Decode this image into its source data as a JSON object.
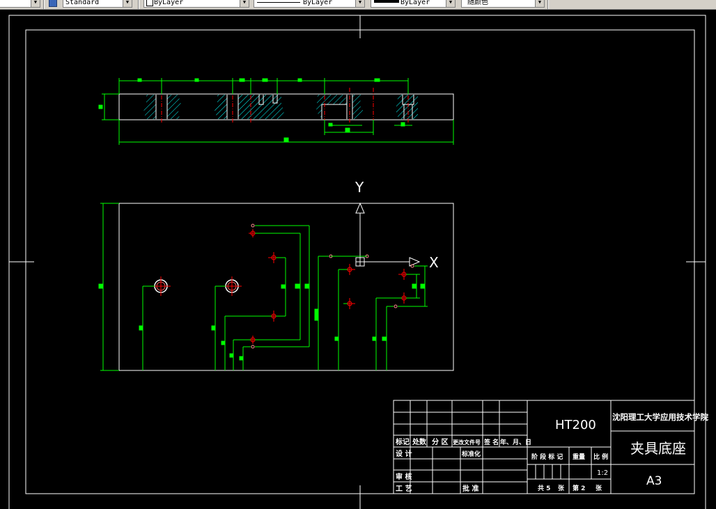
{
  "toolbar": {
    "text_style": "Standard",
    "layer": "ByLayer",
    "linetype": "ByLayer",
    "lineweight": "ByLayer",
    "plot_color": "随颜色"
  },
  "axes": {
    "y_label": "Y",
    "x_label": "X"
  },
  "title_block": {
    "material": "HT200",
    "school": "沈阳理工大学应用技术学院",
    "part_name": "夹具底座",
    "sheet_size": "A3",
    "scale": "1:2",
    "headers": {
      "mark": "标记",
      "count": "处数",
      "zone": "分 区",
      "change_doc": "更改文件号",
      "signature": "签 名",
      "date": "年、月、日"
    },
    "design": "设 计",
    "standardization": "标准化",
    "stage_mark": "阶 段 标 记",
    "weight": "重量",
    "ratio": "比 例",
    "review": "审 核",
    "process": "工 艺",
    "approve": "批 准",
    "total_sheets": "共 5",
    "sheet_word": "张",
    "sheet_no": "第 2",
    "sheet_word2": "张"
  },
  "colors": {
    "background": "#000000",
    "outline": "#ffffff",
    "dimension": "#00ff00",
    "centerline": "#ff0000",
    "hatch": "#00ffff",
    "hole": "#ff8080"
  }
}
